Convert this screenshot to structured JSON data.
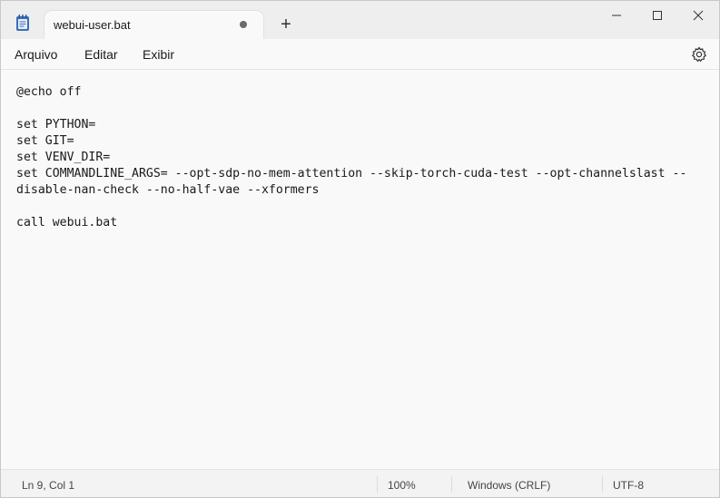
{
  "window": {
    "tab_title": "webui-user.bat",
    "new_tab_symbol": "+"
  },
  "menu": {
    "items": [
      "Arquivo",
      "Editar",
      "Exibir"
    ]
  },
  "editor": {
    "lines": [
      "@echo off",
      "",
      "set PYTHON=",
      "set GIT=",
      "set VENV_DIR=",
      "set COMMANDLINE_ARGS= --opt-sdp-no-mem-attention --skip-torch-cuda-test --opt-channelslast --",
      "disable-nan-check --no-half-vae --xformers",
      "",
      "call webui.bat"
    ]
  },
  "statusbar": {
    "position": "Ln 9, Col 1",
    "zoom": "100%",
    "line_ending": "Windows (CRLF)",
    "encoding": "UTF-8"
  },
  "icons": {
    "app": "notepad-icon",
    "settings": "gear-icon",
    "minimize": "minimize-icon",
    "maximize": "maximize-icon",
    "close": "close-icon"
  },
  "colors": {
    "accent": "#3b6fb6"
  }
}
